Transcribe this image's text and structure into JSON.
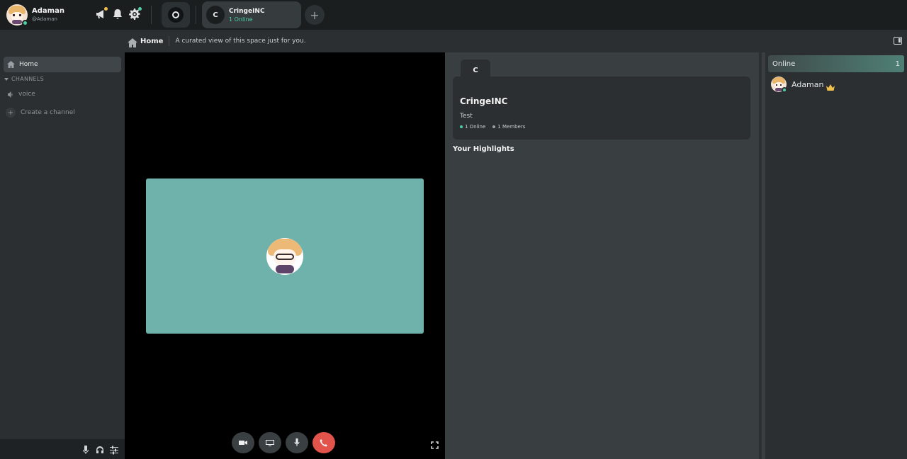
{
  "user": {
    "name": "Adaman",
    "handle": "@Adaman",
    "status_color": "#4fd1a5"
  },
  "top_icons": [
    {
      "name": "megaphone-icon",
      "dot_color": "#f1c04a"
    },
    {
      "name": "bell-icon",
      "dot_color": ""
    },
    {
      "name": "gear-icon",
      "dot_color": "#4fd1a5"
    }
  ],
  "server": {
    "initial": "C",
    "name": "CringeINC",
    "online": "1 Online"
  },
  "add_server_label": "+",
  "breadcrumb": {
    "title": "Home",
    "description": "A curated view of this space just for you."
  },
  "sidebar": {
    "home_label": "Home",
    "category_label": "CHANNELS",
    "channels": [
      {
        "label": "voice",
        "icon": "speaker-icon"
      }
    ],
    "create_label": "Create a channel"
  },
  "call_controls": [
    "camera-icon",
    "screen-share-icon",
    "microphone-icon",
    "hang-up-icon"
  ],
  "space": {
    "tab_initial": "C",
    "name": "CringeINC",
    "description": "Test",
    "online_label": "1 Online",
    "members_label": "1 Members",
    "highlights_title": "Your Highlights"
  },
  "members_panel": {
    "online_label": "Online",
    "online_count": "1",
    "members": [
      {
        "name": "Adaman",
        "badge": "crown-icon"
      }
    ]
  },
  "colors": {
    "accent_green": "#4fd1a5",
    "hangup_red": "#e2534c",
    "video_tile": "#6fb2ab",
    "crown": "#f1c04a"
  }
}
